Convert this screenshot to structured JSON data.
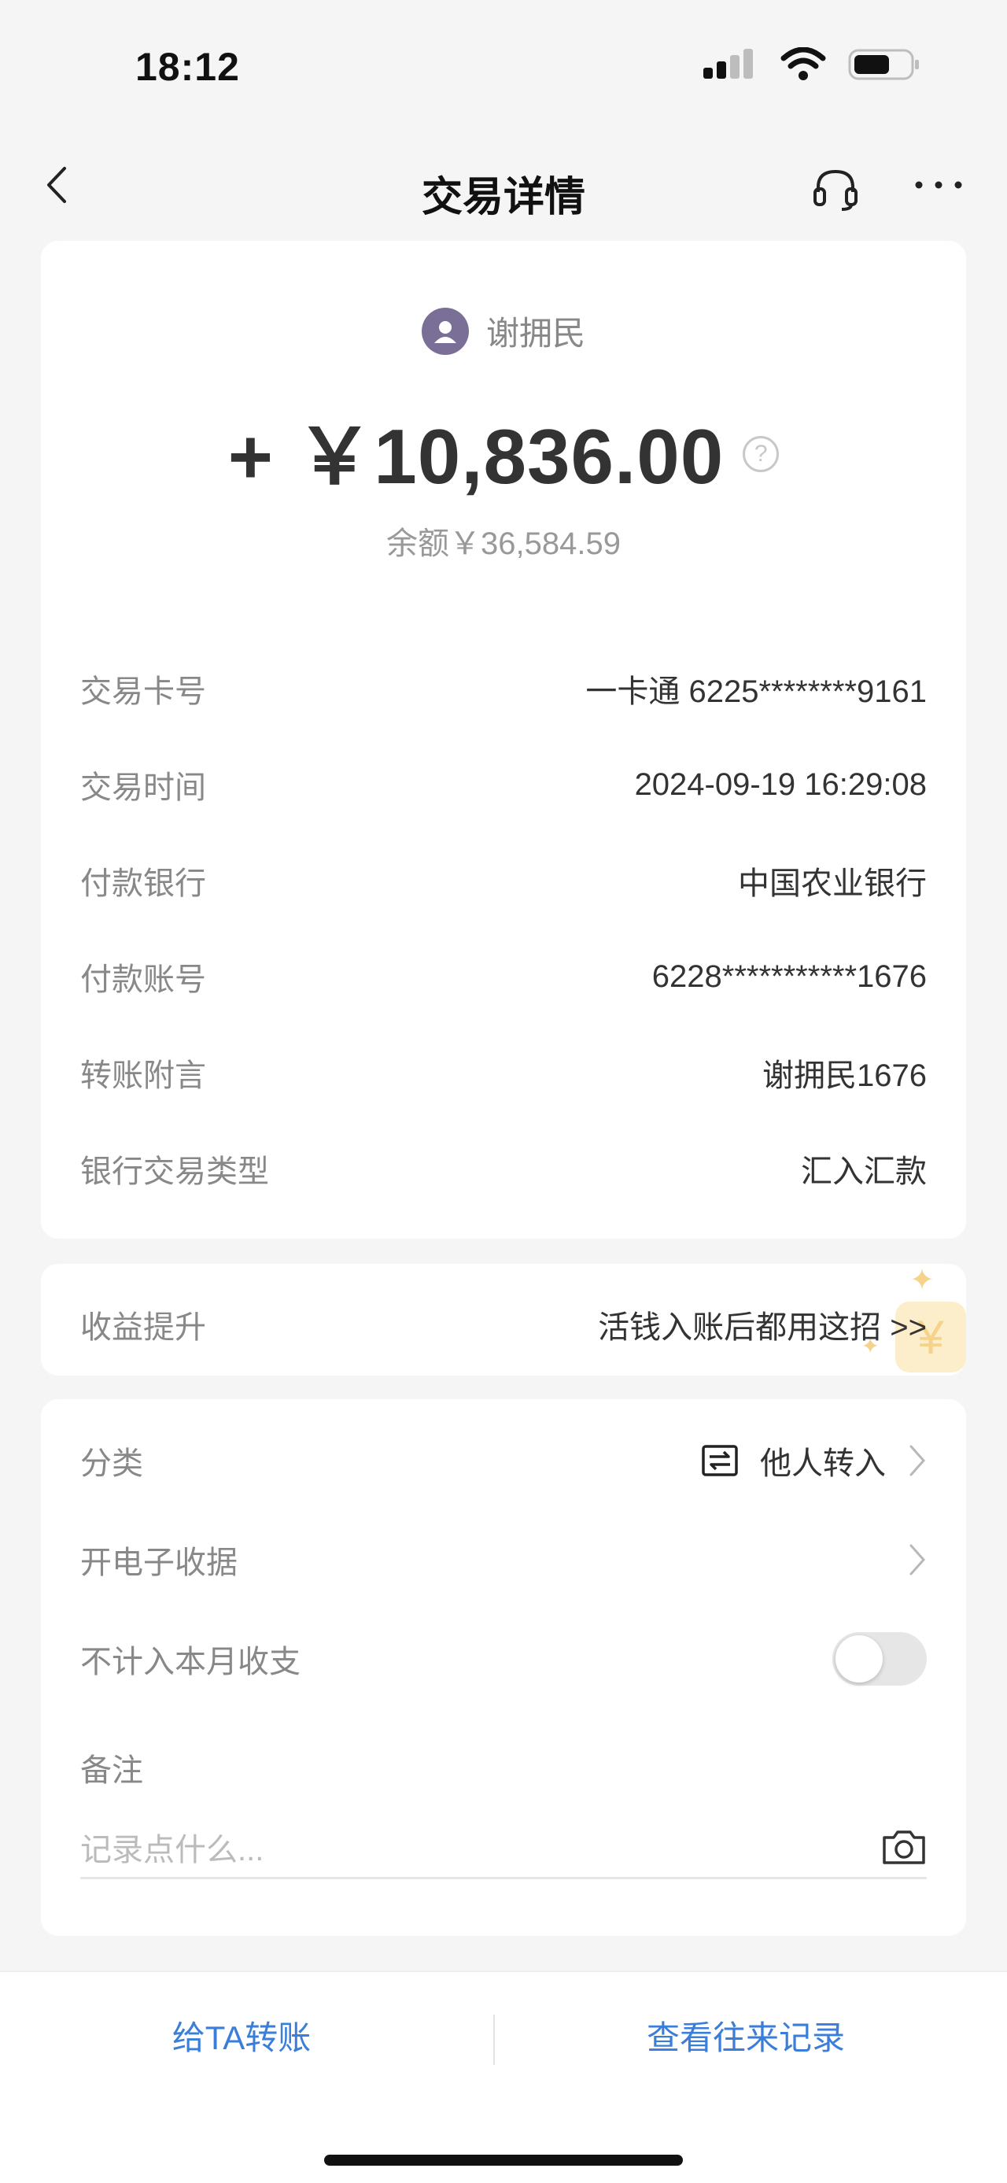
{
  "status_bar": {
    "time": "18:12"
  },
  "nav": {
    "title": "交易详情",
    "back_icon": "chevron-left-icon",
    "service_icon": "headset-icon",
    "more_icon": "more-icon"
  },
  "transaction": {
    "payer_name": "谢拥民",
    "amount": "+ ￥10,836.00",
    "balance": "余额￥36,584.59",
    "details": [
      {
        "label": "交易卡号",
        "value": "一卡通 6225********9161"
      },
      {
        "label": "交易时间",
        "value": "2024-09-19 16:29:08"
      },
      {
        "label": "付款银行",
        "value": "中国农业银行"
      },
      {
        "label": "付款账号",
        "value": "6228***********1676"
      },
      {
        "label": "转账附言",
        "value": "谢拥民1676"
      },
      {
        "label": "银行交易类型",
        "value": "汇入汇款"
      }
    ]
  },
  "promo": {
    "label": "收益提升",
    "text": "活钱入账后都用这招 >>",
    "deco_symbol": "¥"
  },
  "settings": {
    "category_label": "分类",
    "category_value": "他人转入",
    "receipt_label": "开电子收据",
    "exclude_label": "不计入本月收支",
    "exclude_toggle_on": false,
    "note_label": "备注",
    "note_placeholder": "记录点什么..."
  },
  "bottom": {
    "transfer_label": "给TA转账",
    "history_label": "查看往来记录"
  },
  "colors": {
    "accent": "#3a7ed9",
    "avatar": "#7a6f96",
    "background": "#f5f5f5"
  }
}
